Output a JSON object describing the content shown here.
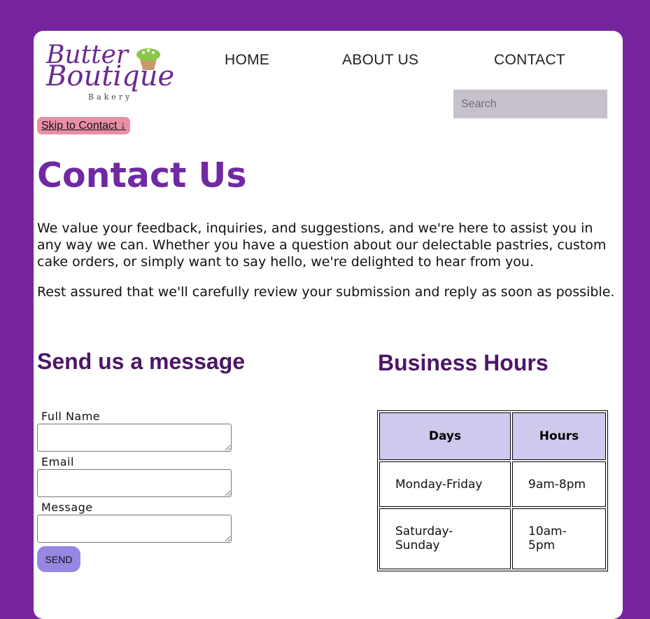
{
  "logo": {
    "line1": "Butter",
    "line2": "Boutique",
    "line3": "Bakery"
  },
  "nav": {
    "items": [
      "HOME",
      "ABOUT US",
      "CONTACT"
    ]
  },
  "search": {
    "placeholder": "Search"
  },
  "skip_link": "Skip to Contact ↓",
  "page_title": "Contact Us",
  "intro": {
    "p1": "We value your feedback, inquiries, and suggestions, and we're here to assist you in any way we can. Whether you have a question about our delectable pastries, custom cake orders, or simply want to say hello, we're delighted to hear from you.",
    "p2": "Rest assured that we'll carefully review your submission and reply as soon as possible."
  },
  "form": {
    "heading": "Send us a message",
    "fields": [
      {
        "label": "Full Name",
        "value": ""
      },
      {
        "label": "Email",
        "value": ""
      },
      {
        "label": "Message",
        "value": ""
      }
    ],
    "submit_label": "SEND"
  },
  "hours": {
    "heading": "Business Hours",
    "headers": [
      "Days",
      "Hours"
    ],
    "rows": [
      [
        "Monday-Friday",
        "9am-8pm"
      ],
      [
        "Saturday-Sunday",
        "10am-5pm"
      ]
    ]
  },
  "colors": {
    "page_background": "#75249e",
    "title": "#7129a3",
    "section_heading": "#4c1566",
    "skip_link_bg": "#e88fa6",
    "send_button_bg": "#9587e2",
    "table_header_bg": "#d0c9ed",
    "search_bg": "#c6c1cb"
  }
}
